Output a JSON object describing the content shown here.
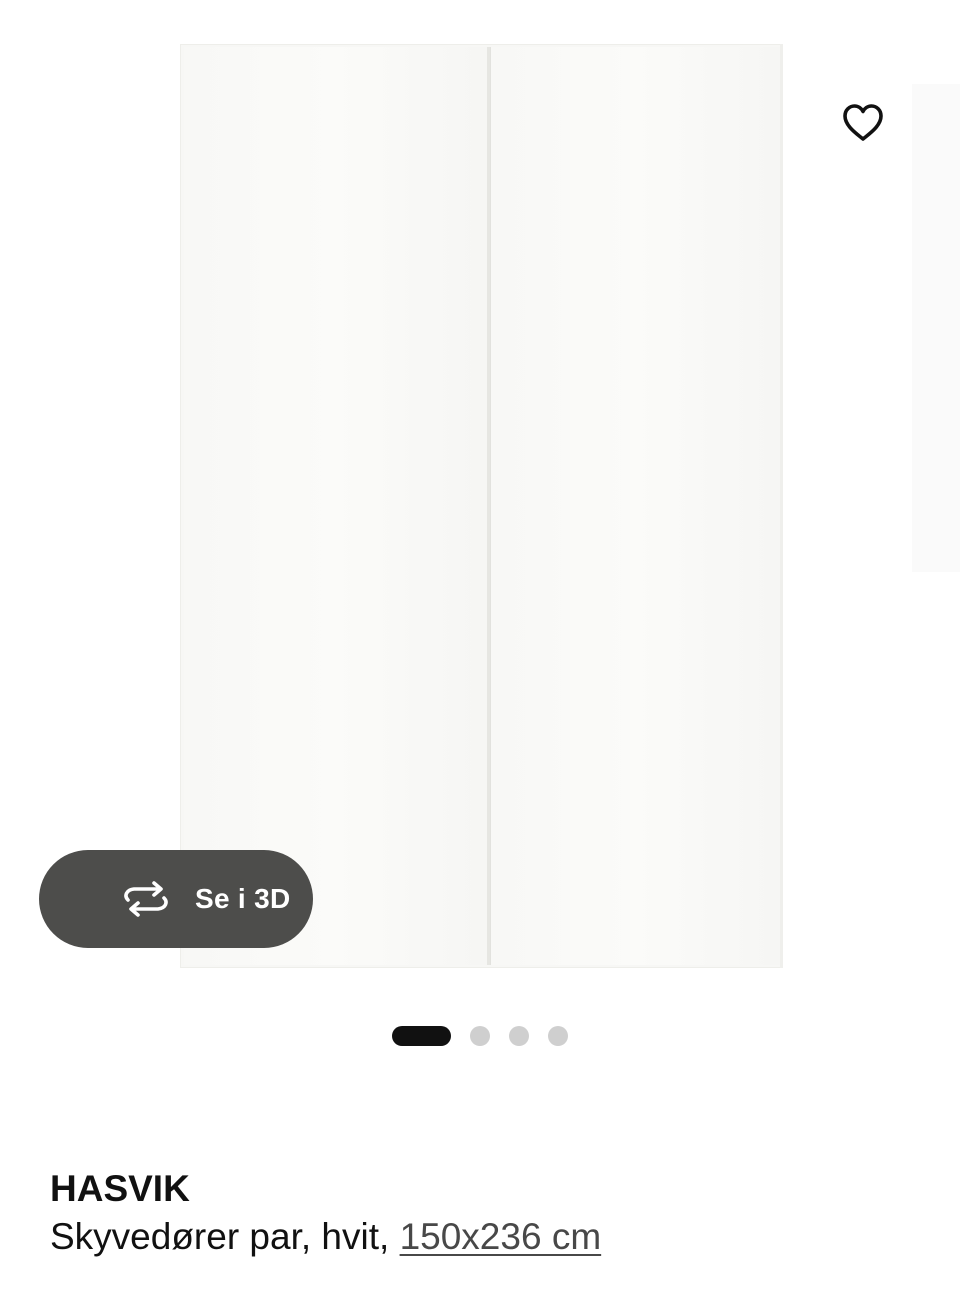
{
  "gallery": {
    "image_alt": "HASVIK Skyvedører par, hvit, 150x236 cm",
    "favorite_icon": "heart-outline-icon",
    "view3d": {
      "icon": "rotate-3d-icon",
      "label": "Se i 3D"
    },
    "pagination": {
      "total": 4,
      "active_index": 0
    }
  },
  "product": {
    "name": "HASVIK",
    "description": "Skyvedører par, hvit, ",
    "size_link": "150x236 cm"
  },
  "colors": {
    "text": "#111111",
    "button_bg": "#4d4d4b",
    "dot_active": "#111111",
    "dot_inactive": "#cfcfcf"
  }
}
